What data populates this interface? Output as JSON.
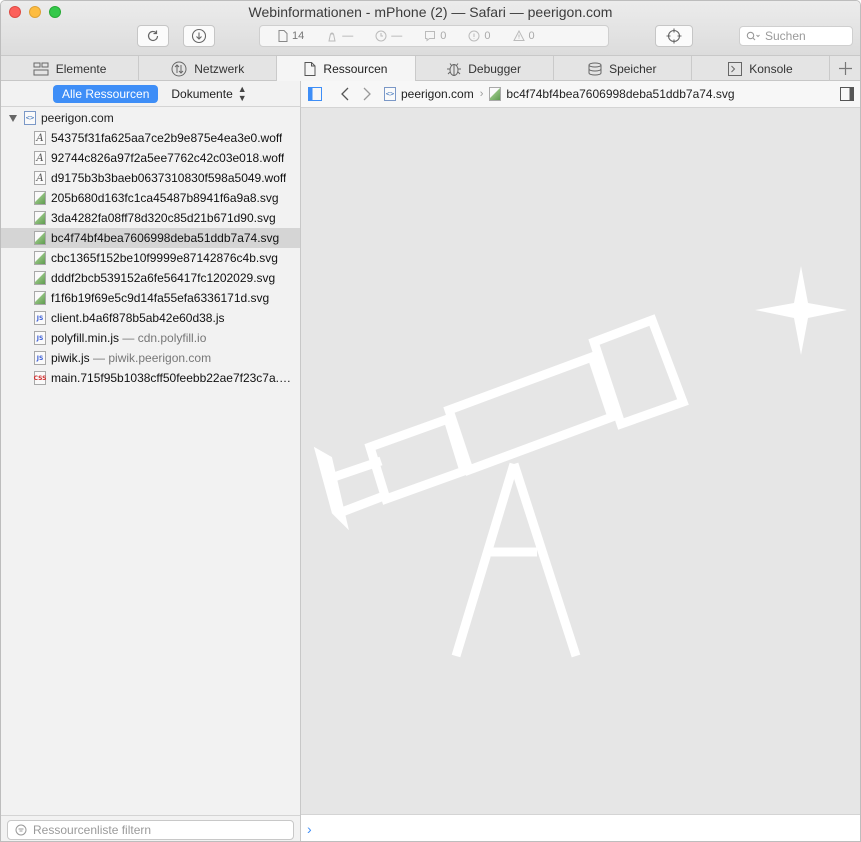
{
  "window": {
    "title": "Webinformationen - mPhone (2) — Safari — peerigon.com"
  },
  "toolbar": {
    "resource_count": "14",
    "load_time": "—",
    "network_time": "—",
    "logs": "0",
    "errors": "0",
    "warnings": "0",
    "search_placeholder": "Suchen"
  },
  "tabs": [
    {
      "label": "Elemente",
      "icon": "elements-icon"
    },
    {
      "label": "Netzwerk",
      "icon": "network-icon"
    },
    {
      "label": "Ressourcen",
      "icon": "resources-icon",
      "selected": true
    },
    {
      "label": "Debugger",
      "icon": "debugger-icon"
    },
    {
      "label": "Speicher",
      "icon": "storage-icon"
    },
    {
      "label": "Konsole",
      "icon": "console-icon"
    }
  ],
  "sidebar": {
    "scope_all": "Alle Ressourcen",
    "scope_select": "Dokumente",
    "root": "peerigon.com",
    "items": [
      {
        "type": "font",
        "name": "54375f31fa625aa7ce2b9e875e4ea3e0.woff"
      },
      {
        "type": "font",
        "name": "92744c826a97f2a5ee7762c42c03e018.woff"
      },
      {
        "type": "font",
        "name": "d9175b3b3baeb0637310830f598a5049.woff"
      },
      {
        "type": "img",
        "name": "205b680d163fc1ca45487b8941f6a9a8.svg"
      },
      {
        "type": "img",
        "name": "3da4282fa08ff78d320c85d21b671d90.svg"
      },
      {
        "type": "img",
        "name": "bc4f74bf4bea7606998deba51ddb7a74.svg",
        "selected": true
      },
      {
        "type": "img",
        "name": "cbc1365f152be10f9999e87142876c4b.svg"
      },
      {
        "type": "img",
        "name": "dddf2bcb539152a6fe56417fc1202029.svg"
      },
      {
        "type": "img",
        "name": "f1f6b19f69e5c9d14fa55efa6336171d.svg"
      },
      {
        "type": "js",
        "name": "client.b4a6f878b5ab42e60d38.js"
      },
      {
        "type": "js",
        "name": "polyfill.min.js",
        "origin": "— cdn.polyfill.io"
      },
      {
        "type": "js",
        "name": "piwik.js",
        "origin": "— piwik.peerigon.com"
      },
      {
        "type": "css",
        "name": "main.715f95b1038cff50feebb22ae7f23c7a.c…"
      }
    ],
    "filter_placeholder": "Ressourcenliste filtern"
  },
  "content": {
    "breadcrumb_root": "peerigon.com",
    "breadcrumb_file": "bc4f74bf4bea7606998deba51ddb7a74.svg",
    "console_prompt": "›"
  },
  "colors": {
    "accent": "#3e8ef7",
    "preview_bg": "#e6e6e6",
    "selected_row": "#d5d5d5"
  }
}
